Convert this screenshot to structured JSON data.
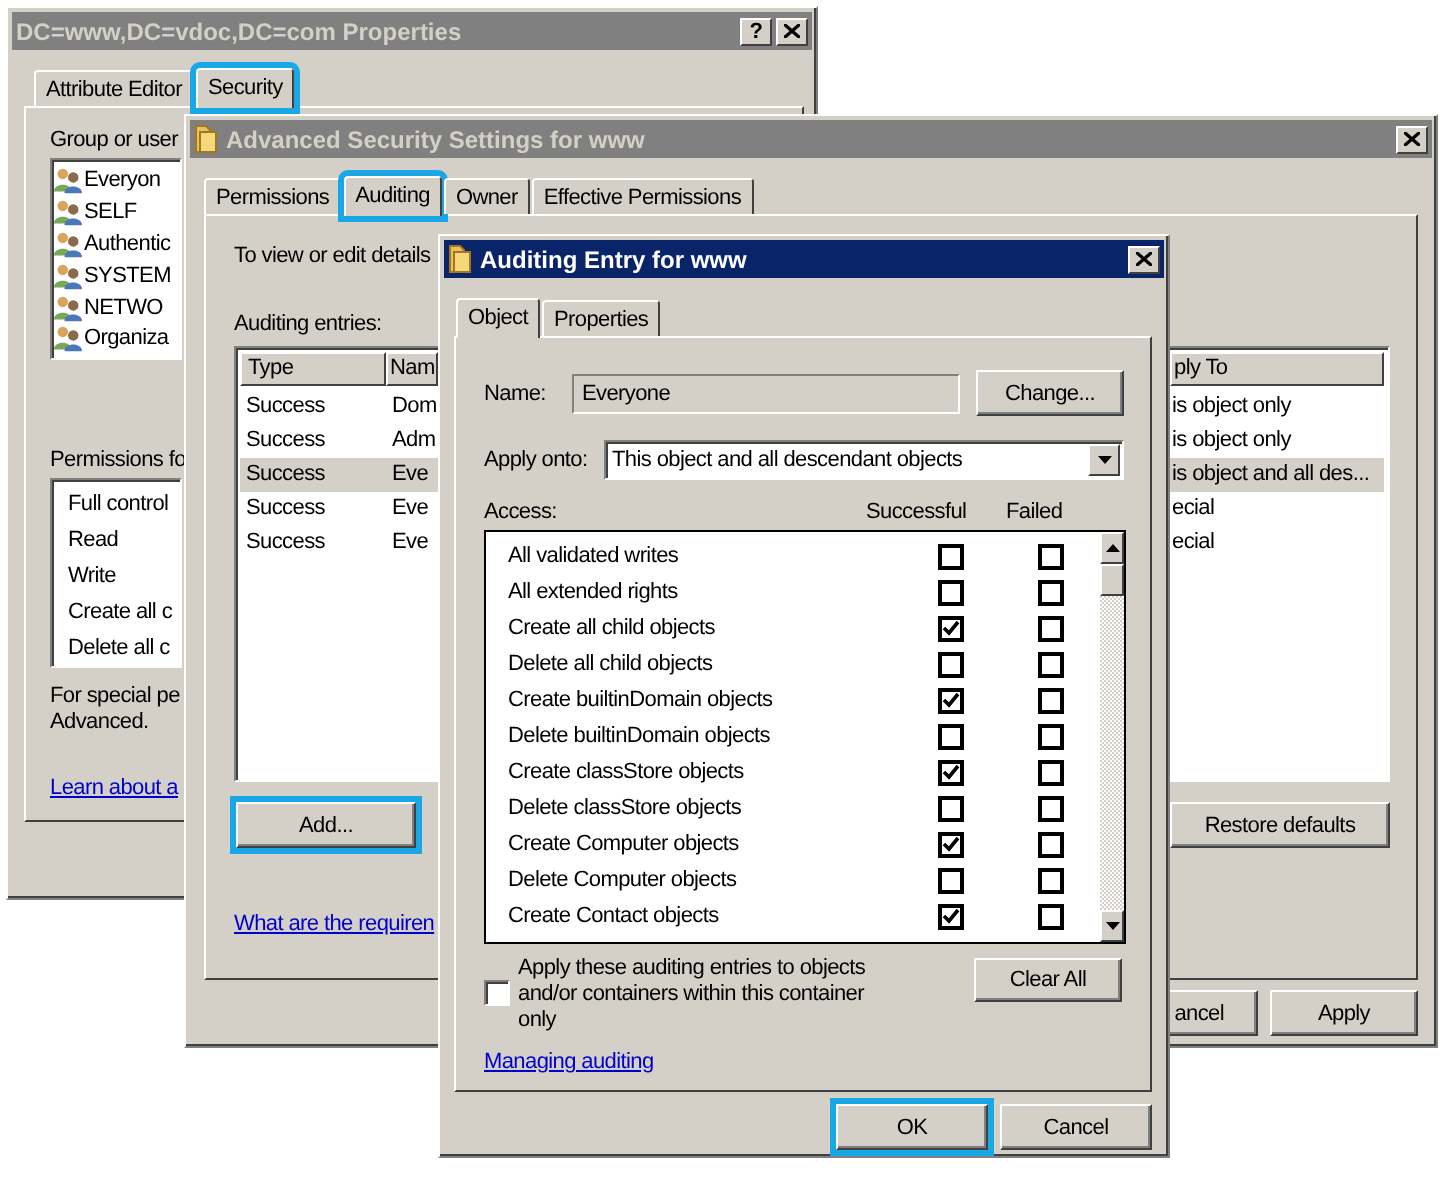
{
  "properties_window": {
    "title": "DC=www,DC=vdoc,DC=com Properties",
    "active": false,
    "help": "?",
    "tabs": [
      {
        "label": "Attribute Editor",
        "selected": false,
        "highlighted": false
      },
      {
        "label": "Security",
        "selected": true,
        "highlighted": true
      }
    ],
    "group_label": "Group or user",
    "users": [
      "Everyon",
      "SELF",
      "Authentic",
      "SYSTEM",
      "NETWO",
      "Organiza"
    ],
    "permissions_label": "Permissions fo",
    "permissions": [
      "Full control",
      "Read",
      "Write",
      "Create all c",
      "Delete all c"
    ],
    "note": [
      "For special pe",
      "Advanced."
    ],
    "link": "Learn about a"
  },
  "advanced_window": {
    "title": "Advanced Security Settings for www",
    "active": false,
    "tabs": [
      {
        "label": "Permissions",
        "selected": false,
        "highlighted": false
      },
      {
        "label": "Auditing",
        "selected": true,
        "highlighted": true
      },
      {
        "label": "Owner",
        "selected": false,
        "highlighted": false
      },
      {
        "label": "Effective Permissions",
        "selected": false,
        "highlighted": false
      }
    ],
    "intro": "To view or edit details",
    "entries_label": "Auditing entries:",
    "columns": [
      "Type",
      "Nam",
      "ply To"
    ],
    "rows": [
      {
        "type": "Success",
        "name": "Dom",
        "apply_to": "is object only",
        "selected": false
      },
      {
        "type": "Success",
        "name": "Adm",
        "apply_to": "is object only",
        "selected": false
      },
      {
        "type": "Success",
        "name": "Eve",
        "apply_to": "is object and all des...",
        "selected": true
      },
      {
        "type": "Success",
        "name": "Eve",
        "apply_to": "ecial",
        "selected": false
      },
      {
        "type": "Success",
        "name": "Eve",
        "apply_to": "ecial",
        "selected": false
      }
    ],
    "add_button": {
      "label": "Add...",
      "highlighted": true
    },
    "restore_button": "Restore defaults",
    "link": "What are the requiren",
    "cancel_button": "ancel",
    "apply_button": "Apply"
  },
  "entry_window": {
    "title": "Auditing Entry for www",
    "active": true,
    "tabs": [
      {
        "label": "Object",
        "selected": true,
        "highlighted": false
      },
      {
        "label": "Properties",
        "selected": false,
        "highlighted": false
      }
    ],
    "name_label": "Name:",
    "name_value": "Everyone",
    "change_button": "Change...",
    "apply_label": "Apply onto:",
    "apply_value": "This object and all descendant objects",
    "access_label": "Access:",
    "successful_label": "Successful",
    "failed_label": "Failed",
    "access": [
      {
        "label": "All validated writes",
        "successful": false,
        "failed": false
      },
      {
        "label": "All extended rights",
        "successful": false,
        "failed": false
      },
      {
        "label": "Create all child objects",
        "successful": true,
        "failed": false
      },
      {
        "label": "Delete all child objects",
        "successful": false,
        "failed": false
      },
      {
        "label": "Create builtinDomain objects",
        "successful": true,
        "failed": false
      },
      {
        "label": "Delete builtinDomain objects",
        "successful": false,
        "failed": false
      },
      {
        "label": "Create classStore objects",
        "successful": true,
        "failed": false
      },
      {
        "label": "Delete classStore objects",
        "successful": false,
        "failed": false
      },
      {
        "label": "Create Computer objects",
        "successful": true,
        "failed": false
      },
      {
        "label": "Delete Computer objects",
        "successful": false,
        "failed": false
      },
      {
        "label": "Create Contact objects",
        "successful": true,
        "failed": false
      }
    ],
    "apply_children": {
      "label": "Apply these auditing entries to objects and/or containers within this container only",
      "checked": false
    },
    "clear_button": "Clear All",
    "link": "Managing auditing",
    "ok_button": {
      "label": "OK",
      "highlighted": true
    },
    "cancel_button": "Cancel"
  }
}
